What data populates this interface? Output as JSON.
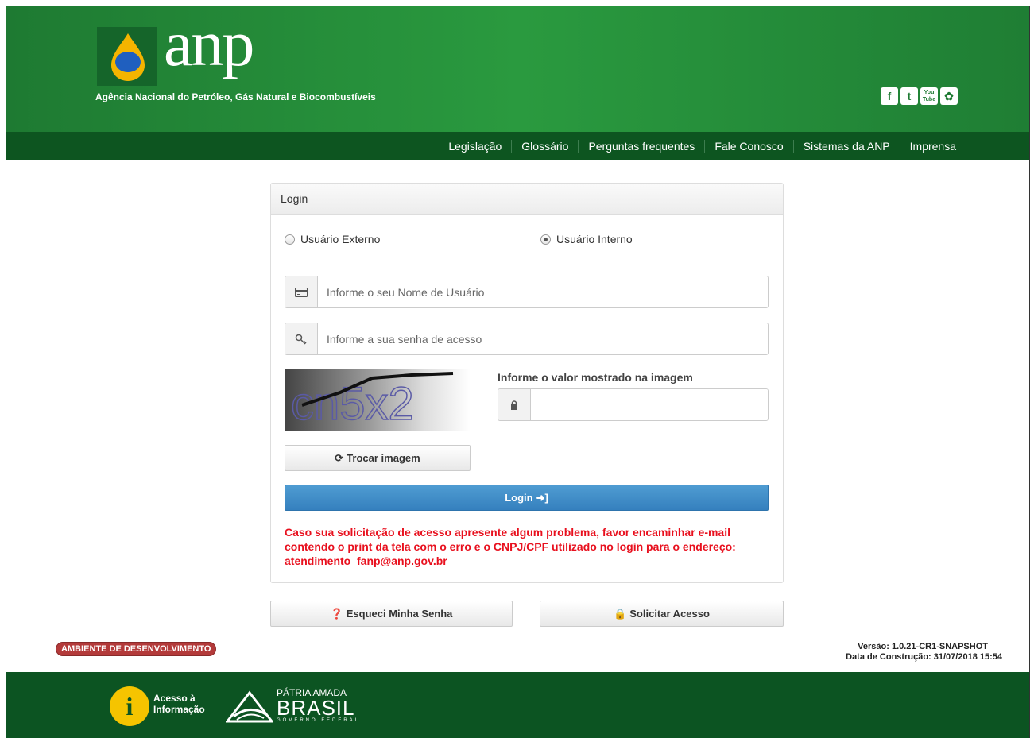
{
  "header": {
    "logo_text": "anp",
    "agency_name": "Agência Nacional do Petróleo, Gás Natural e Biocombustíveis",
    "social": [
      "facebook-icon",
      "twitter-icon",
      "youtube-icon",
      "flickr-icon"
    ]
  },
  "nav": {
    "items": [
      "Legislação",
      "Glossário",
      "Perguntas frequentes",
      "Fale Conosco",
      "Sistemas da ANP",
      "Imprensa"
    ]
  },
  "login": {
    "panel_title": "Login",
    "radio_external": "Usuário Externo",
    "radio_internal": "Usuário Interno",
    "selected": "Usuário Interno",
    "username_placeholder": "Informe o seu Nome de Usuário",
    "password_placeholder": "Informe a sua senha de acesso",
    "captcha_text": "cn5x2",
    "captcha_label": "Informe o valor mostrado na imagem",
    "captcha_value": "",
    "refresh_label": "Trocar imagem",
    "login_label": "Login",
    "warning": "Caso sua solicitação de acesso apresente algum problema, favor encaminhar e-mail contendo o print da tela com o erro e o CNPJ/CPF utilizado no login para o endereço: atendimento_fanp@anp.gov.br"
  },
  "actions": {
    "forgot_label": "Esqueci Minha Senha",
    "request_label": "Solicitar Acesso"
  },
  "environment": "AMBIENTE DE DESENVOLVIMENTO",
  "version": {
    "line1": "Versão: 1.0.21-CR1-SNAPSHOT",
    "line2": "Data de Construção: 31/07/2018 15:54"
  },
  "footer": {
    "info_line1": "Acesso à",
    "info_line2": "Informação",
    "brasil_line1": "PÁTRIA AMADA",
    "brasil_line2": "BRASIL",
    "brasil_line3": "GOVERNO FEDERAL"
  },
  "colors": {
    "header_green": "#1e7a32",
    "nav_green": "#0d5520",
    "login_blue": "#3a8bc8",
    "warning_red": "#e8101e"
  }
}
